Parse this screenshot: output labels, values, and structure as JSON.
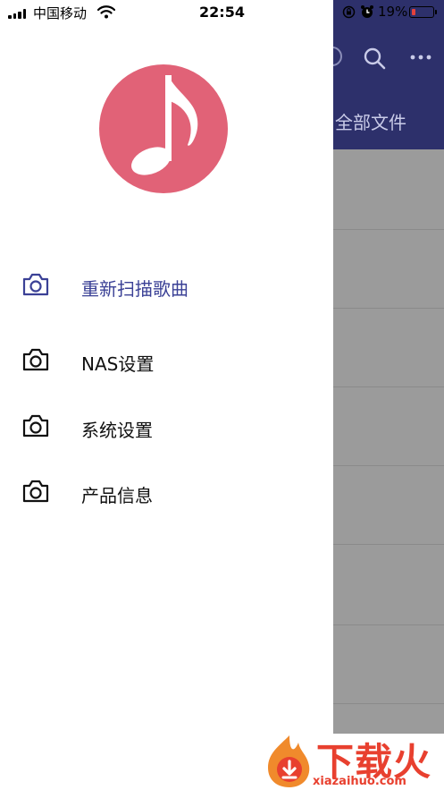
{
  "status_bar": {
    "carrier": "中国移动",
    "time": "22:54",
    "battery_percent": "19%",
    "battery_level": 0.19,
    "icons": [
      "signal-bars-icon",
      "wifi-icon",
      "rotation-lock-icon",
      "alarm-clock-icon",
      "battery-icon"
    ]
  },
  "background_app": {
    "header_color": "#2d306b",
    "tab_label": "全部文件",
    "icons": [
      "search-icon",
      "more-icon"
    ]
  },
  "drawer": {
    "avatar_icon": "music-note-icon",
    "avatar_color": "#e16277",
    "accent_color": "#3b4196",
    "items": [
      {
        "label": "重新扫描歌曲",
        "icon": "camera-icon",
        "active": true
      },
      {
        "label": "NAS设置",
        "icon": "camera-icon",
        "active": false
      },
      {
        "label": "系统设置",
        "icon": "camera-icon",
        "active": false
      },
      {
        "label": "产品信息",
        "icon": "camera-icon",
        "active": false
      }
    ]
  },
  "watermark": {
    "brand": "下载火",
    "url": "xiazaihuo.com",
    "color": "#e8402f"
  }
}
